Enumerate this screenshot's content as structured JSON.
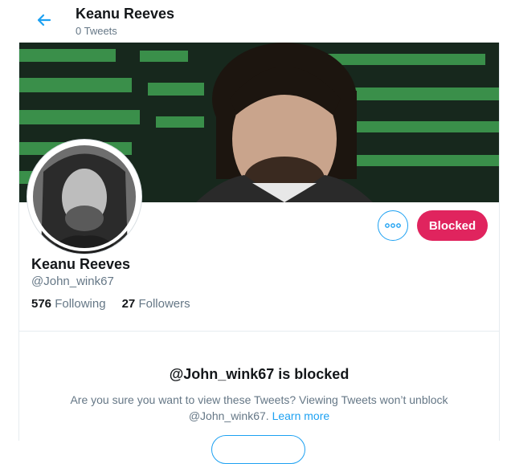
{
  "header": {
    "title": "Keanu Reeves",
    "tweet_count": "0 Tweets"
  },
  "profile": {
    "name": "Keanu Reeves",
    "handle": "@John_wink67",
    "following_count": "576",
    "following_label": "Following",
    "followers_count": "27",
    "followers_label": "Followers"
  },
  "actions": {
    "more_icon": "more-horizontal-icon",
    "blocked_label": "Blocked"
  },
  "blocked_notice": {
    "title": "@John_wink67 is blocked",
    "text_1": "Are you sure you want to view these Tweets? Viewing Tweets won’t unblock",
    "handle": "@John_wink67.",
    "link": "Learn more"
  },
  "colors": {
    "accent": "#1da1f2",
    "blocked": "#e0245e",
    "secondary_text": "#657786"
  }
}
